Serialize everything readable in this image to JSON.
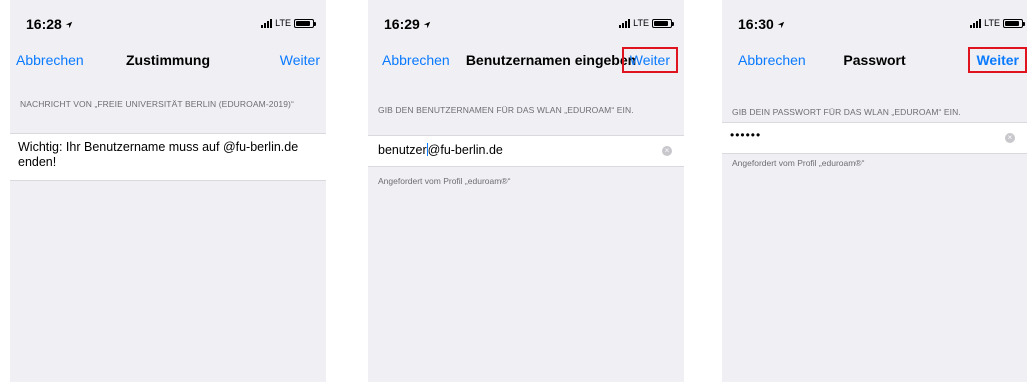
{
  "screens": [
    {
      "status_time": "16:28",
      "network": "LTE",
      "nav": {
        "left": "Abbrechen",
        "title": "Zustimmung",
        "right": "Weiter"
      },
      "section_header": "NACHRICHT VON „FREIE UNIVERSITÄT BERLIN (EDUROAM-2019)“",
      "message": "Wichtig: Ihr Benutzername muss auf @fu-berlin.de enden!"
    },
    {
      "status_time": "16:29",
      "network": "LTE",
      "nav": {
        "left": "Abbrechen",
        "title": "Benutzernamen eingeben",
        "right": "Weiter"
      },
      "section_header": "GIB DEN BENUTZERNAMEN FÜR DAS WLAN „EDUROAM“ EIN.",
      "username_before_cursor": "benutzer",
      "username_after_cursor": "@fu-berlin.de",
      "footer": "Angefordert vom Profil „eduroam®“"
    },
    {
      "status_time": "16:30",
      "network": "LTE",
      "nav": {
        "left": "Abbrechen",
        "title": "Passwort",
        "right": "Weiter"
      },
      "section_header": "GIB DEIN PASSWORT FÜR DAS WLAN „EDUROAM“ EIN.",
      "password_mask": "••••••",
      "footer": "Angefordert vom Profil „eduroam®“"
    }
  ],
  "colors": {
    "accent": "#0a7aff",
    "highlight_box": "#e0141e",
    "background": "#efeff4"
  }
}
